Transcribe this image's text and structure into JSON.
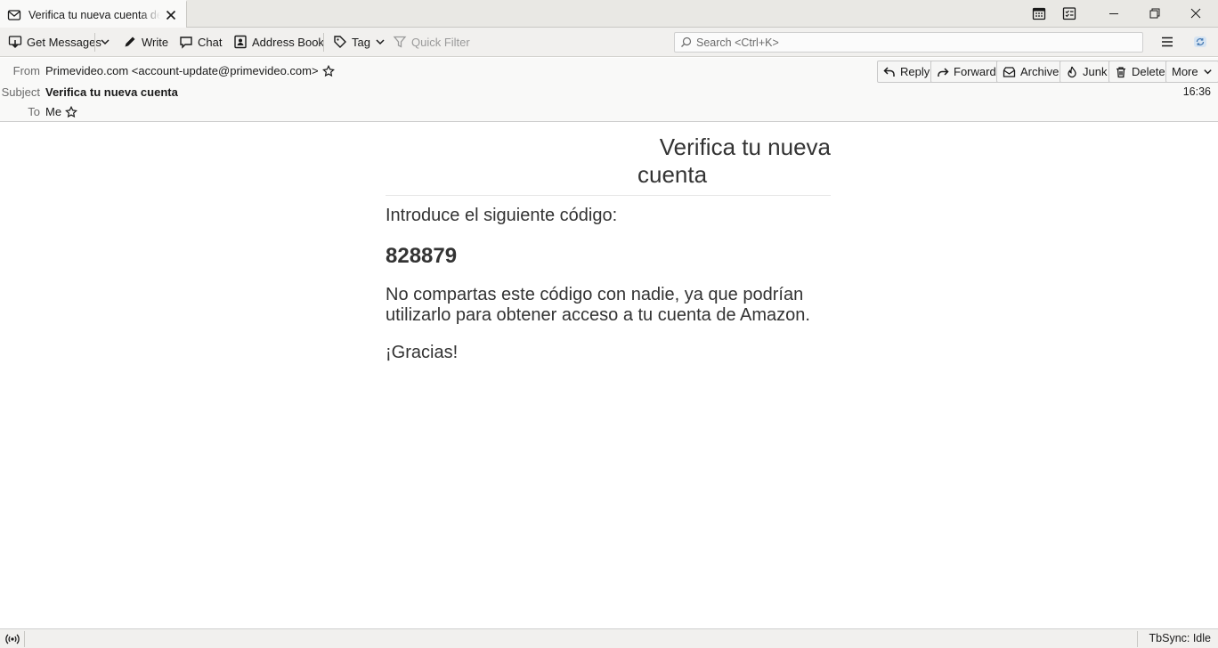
{
  "tab": {
    "title": "Verifica tu nueva cuenta de Amazon"
  },
  "toolbar": {
    "get_messages": "Get Messages",
    "write": "Write",
    "chat": "Chat",
    "address_book": "Address Book",
    "tag": "Tag",
    "quick_filter": "Quick Filter",
    "search_placeholder": "Search <Ctrl+K>"
  },
  "header": {
    "from_label": "From",
    "from_value": "Primevideo.com <account-update@primevideo.com>",
    "subject_label": "Subject",
    "subject_value": "Verifica tu nueva cuenta",
    "to_label": "To",
    "to_value": "Me",
    "time": "16:36",
    "actions": {
      "reply": "Reply",
      "forward": "Forward",
      "archive": "Archive",
      "junk": "Junk",
      "delete": "Delete",
      "more": "More"
    }
  },
  "message": {
    "title_line1": "Verifica tu nueva",
    "title_line2": "cuenta",
    "intro": "Introduce el siguiente código:",
    "code": "828879",
    "warning": "No compartas este código con nadie, ya que podrían utilizarlo para obtener acceso a tu cuenta de Amazon.",
    "thanks": "¡Gracias!"
  },
  "status": {
    "tbsync": "TbSync: Idle"
  }
}
